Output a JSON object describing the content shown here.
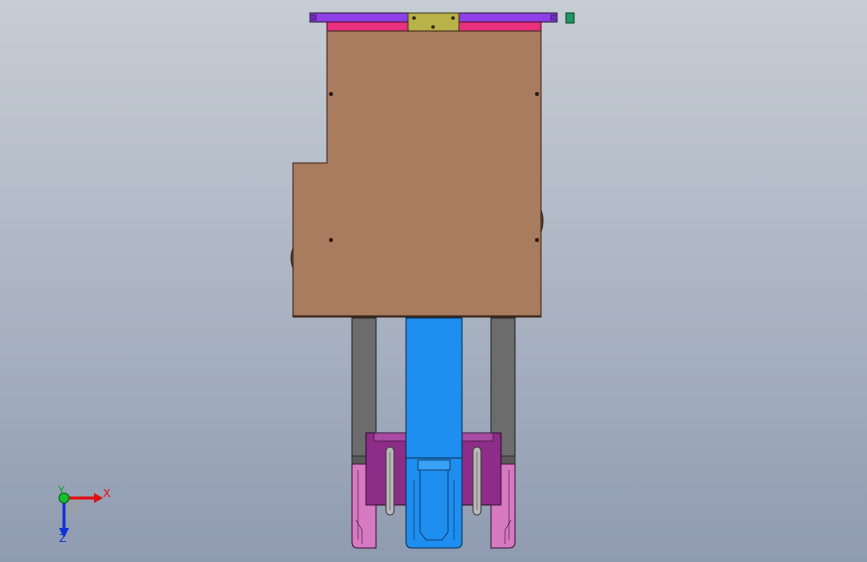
{
  "view": {
    "colors": {
      "background_top": "#c7cdd5",
      "background_bottom": "#8f9bb0",
      "top_rail": "#8f3fe6",
      "magenta_strip": "#e8307e",
      "connector_plate": "#b9b248",
      "main_body": "#a97c60",
      "cylinder": "#1e8ff0",
      "guide_rods": "#6c6c6c",
      "jaw_blocks": "#8d2d88",
      "fingers": "#d77ac2",
      "small_tab": "#1f9a63"
    }
  },
  "triad": {
    "x_label": "X",
    "y_label": "Y",
    "z_label": "Z",
    "icon": "coordinate-triad"
  }
}
